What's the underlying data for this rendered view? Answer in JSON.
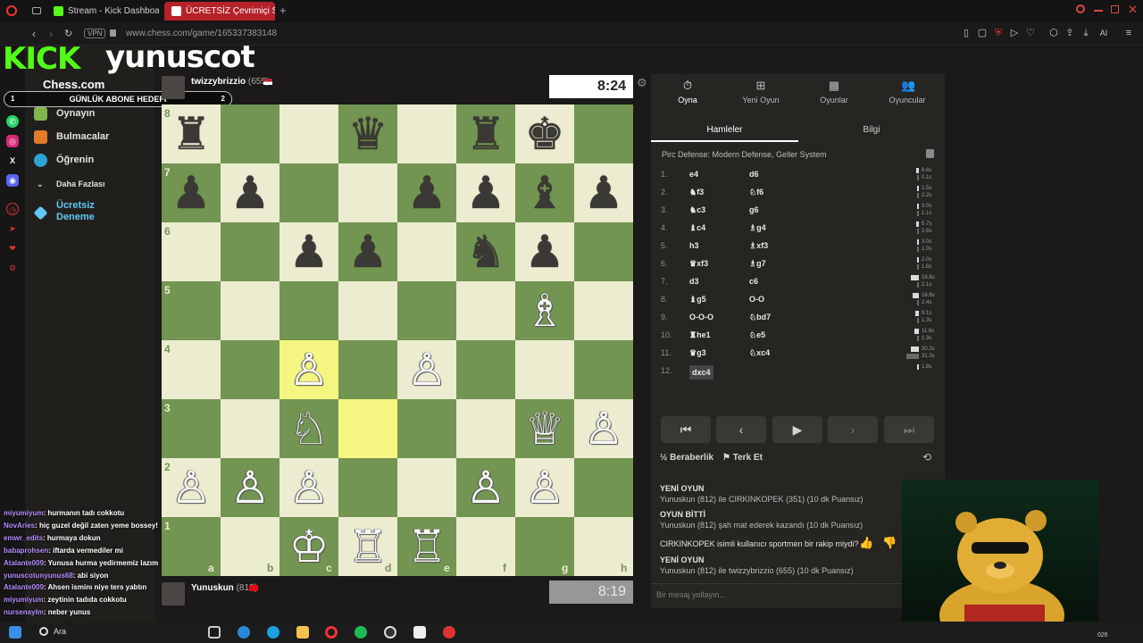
{
  "browser": {
    "tabs": [
      {
        "title": "Stream - Kick Dashboard",
        "active": false
      },
      {
        "title": "ÜCRETSİZ Çevrimiçi Satra",
        "active": true
      }
    ],
    "vpn_label": "VPN",
    "url": "www.chess.com/game/165337383148",
    "ai_label": "AI"
  },
  "overlay": {
    "kick_logo": "KICK",
    "streamer": "yunuscot",
    "sub_goal_label": "GÜNLÜK ABONE HEDEFİ",
    "sub_goal_current": "1",
    "sub_goal_target": "2"
  },
  "nav": {
    "logo": "Chess.com",
    "items": [
      "Oynayın",
      "Bulmacalar",
      "Öğrenin",
      "Daha Fazlası",
      "Ücretsiz Deneme"
    ]
  },
  "players": {
    "top": {
      "name": "twizzybrizzio",
      "rating": "(655)",
      "clock": "8:24"
    },
    "bottom": {
      "name": "Yunuskun",
      "rating": "(812)",
      "clock": "8:19"
    }
  },
  "board": {
    "files": [
      "a",
      "b",
      "c",
      "d",
      "e",
      "f",
      "g",
      "h"
    ],
    "ranks": [
      "8",
      "7",
      "6",
      "5",
      "4",
      "3",
      "2",
      "1"
    ],
    "highlights": [
      "c4",
      "d3"
    ],
    "pieces": {
      "a8": "♜",
      "d8": "♛",
      "f8": "♜",
      "g8": "♚",
      "a7": "♟",
      "b7": "♟",
      "e7": "♟",
      "f7": "♟",
      "g7": "♝",
      "h7": "♟",
      "c6": "♟",
      "d6": "♟",
      "f6": "♞",
      "g6": "♟",
      "g5": "♗",
      "c4": "♙",
      "e4": "♙",
      "c3": "♘",
      "g3": "♕",
      "h3": "♙",
      "a2": "♙",
      "b2": "♙",
      "c2": "♙",
      "f2": "♙",
      "g2": "♙",
      "c1": "♔",
      "d1": "♖",
      "e1": "♖"
    }
  },
  "panel": {
    "tabs": [
      "Oyna",
      "Yeni Oyun",
      "Oyunlar",
      "Oyuncular"
    ],
    "subtabs": [
      "Hamleler",
      "Bilgi"
    ],
    "opening": "Pirc Defense: Modern Defense, Geller System",
    "moves": [
      {
        "n": "1.",
        "w": "e4",
        "b": "d6",
        "tw": "6.6s",
        "tb": "0.1s"
      },
      {
        "n": "2.",
        "w": "♞f3",
        "b": "♘f6",
        "tw": "1.5s",
        "tb": "2.2s"
      },
      {
        "n": "3.",
        "w": "♞c3",
        "b": "g6",
        "tw": "3.0s",
        "tb": "1.1s"
      },
      {
        "n": "4.",
        "w": "♝c4",
        "b": "♗g4",
        "tw": "5.7s",
        "tb": "2.6s"
      },
      {
        "n": "5.",
        "w": "h3",
        "b": "♗xf3",
        "tw": "3.0s",
        "tb": "1.0s"
      },
      {
        "n": "6.",
        "w": "♛xf3",
        "b": "♗g7",
        "tw": "2.0s",
        "tb": "1.6s"
      },
      {
        "n": "7.",
        "w": "d3",
        "b": "c6",
        "tw": "19.6s",
        "tb": "2.1s"
      },
      {
        "n": "8.",
        "w": "♝g5",
        "b": "O-O",
        "tw": "16.6s",
        "tb": "2.4s"
      },
      {
        "n": "9.",
        "w": "O-O-O",
        "b": "♘bd7",
        "tw": "9.1s",
        "tb": "1.3s"
      },
      {
        "n": "10.",
        "w": "♜he1",
        "b": "♘e5",
        "tw": "11.6s",
        "tb": "1.3s"
      },
      {
        "n": "11.",
        "w": "♛g3",
        "b": "♘xc4",
        "tw": "20.2s",
        "tb": "31.3s"
      },
      {
        "n": "12.",
        "w": "dxc4",
        "b": "",
        "tw": "1.8s",
        "tb": ""
      }
    ],
    "controls": [
      "⏮",
      "‹",
      "▶",
      "›",
      "⏭"
    ],
    "draw_label": "Beraberlik",
    "draw_prefix": "½",
    "resign_label": "Terk Et",
    "events": [
      {
        "head": "YENİ OYUN",
        "text": "Yunuskun (812) ile CIRKINKOPEK (351) (10 dk Puansız)"
      },
      {
        "head": "OYUN BİTTİ",
        "text": "Yunuskun (812) şah mat ederek kazandı (10 dk Puansız)"
      },
      {
        "head": "",
        "text": "CIRKINKOPEK isimli kullanıcı sportmen bir rakip miydi?"
      },
      {
        "head": "YENİ OYUN",
        "text": "Yunuskun (812) ile twizzybrizzio (655) (10 dk Puansız)"
      }
    ],
    "message_placeholder": "Bir mesaj yollayın..."
  },
  "chat": [
    {
      "user": "miyumiyum",
      "msg": ": hurmanın tadı cokkotu"
    },
    {
      "user": "NovAries",
      "msg": ": hiç guzel değil zaten yeme bossey!"
    },
    {
      "user": "emwr_edits",
      "msg": ": hurmaya dokun"
    },
    {
      "user": "babaprohsen",
      "msg": ": iftarda vermediler mi"
    },
    {
      "user": "Atalante009",
      "msg": ": Yunusa hurma yedirmemiz lazım"
    },
    {
      "user": "yunuscotunyunus68",
      "msg": ": abi siyon"
    },
    {
      "user": "Atalante009",
      "msg": ": Ahsen isminı niye ters yabtın"
    },
    {
      "user": "miyumiyum",
      "msg": ": zeytinin tadıda cokkotu"
    },
    {
      "user": "nursenaylm",
      "msg": ": neber yunus"
    }
  ],
  "taskbar": {
    "search_label": "Ara",
    "time_partial": "026"
  },
  "colors": {
    "board_light": "#ebecd0",
    "board_dark": "#739552",
    "highlight": "#f5f682",
    "kick_green": "#53fc18"
  }
}
